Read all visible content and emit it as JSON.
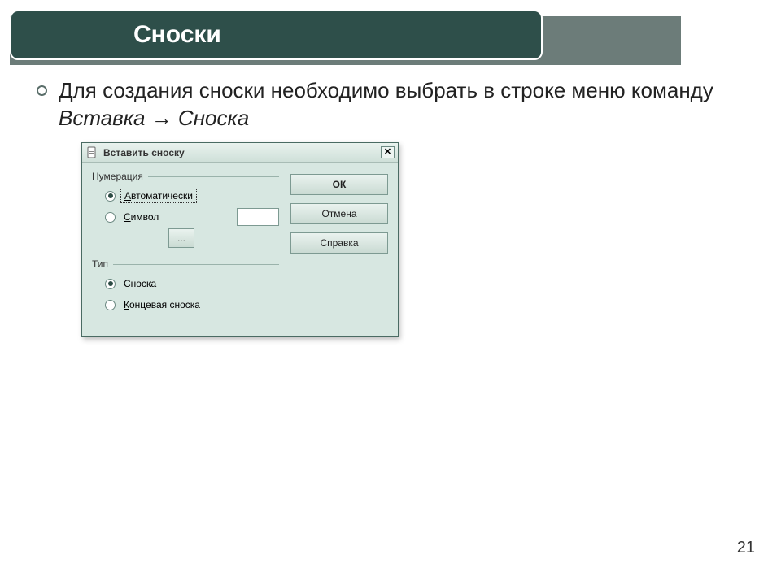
{
  "slide": {
    "title": "Сноски",
    "bullet_prefix": "Для создания сноски необходимо выбрать в строке меню команду ",
    "bullet_emph": "Вставка → Сноска",
    "page_number": "21"
  },
  "dialog": {
    "title": "Вставить сноску",
    "close_glyph": "✕",
    "buttons": {
      "ok": "ОК",
      "cancel": "Отмена",
      "help": "Справка"
    },
    "group_numbering": {
      "label": "Нумерация",
      "option_auto": "Автоматически",
      "option_symbol": "Символ",
      "browse_label": "..."
    },
    "group_type": {
      "label": "Тип",
      "option_footnote": "Сноска",
      "option_endnote": "Концевая сноска"
    }
  }
}
